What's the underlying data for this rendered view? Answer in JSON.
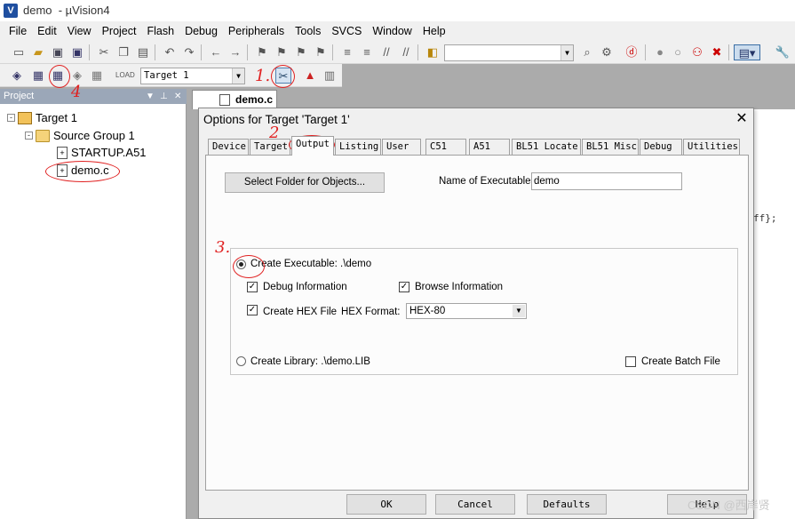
{
  "window": {
    "title": "demo  - µVision4"
  },
  "menu": [
    "File",
    "Edit",
    "View",
    "Project",
    "Flash",
    "Debug",
    "Peripherals",
    "Tools",
    "SVCS",
    "Window",
    "Help"
  ],
  "toolbar": {
    "target_combo": "Target 1"
  },
  "project_pane": {
    "title": "Project",
    "tree": {
      "target": "Target 1",
      "group": "Source Group 1",
      "files": [
        "STARTUP.A51",
        "demo.c"
      ]
    }
  },
  "editor": {
    "tab_label": "demo.c",
    "code_fragment": "ff};"
  },
  "dialog": {
    "title": "Options for Target 'Target 1'",
    "tabs": [
      "Device",
      "Target",
      "Output",
      "Listing",
      "User",
      "C51",
      "A51",
      "BL51 Locate",
      "BL51 Misc",
      "Debug",
      "Utilities"
    ],
    "active_tab": "Output",
    "select_folder_button": "Select Folder for Objects...",
    "name_of_executable_label": "Name of Executable:",
    "name_of_executable_value": "demo",
    "create_executable_label": "Create Executable:  .\\demo",
    "debug_information_label": "Debug Information",
    "browse_information_label": "Browse Information",
    "create_hex_label": "Create HEX File",
    "hex_format_label": "HEX Format:",
    "hex_format_value": "HEX-80",
    "create_library_label": "Create Library:  .\\demo.LIB",
    "create_batch_label": "Create Batch File",
    "ok_button": "OK",
    "cancel_button": "Cancel",
    "defaults_button": "Defaults",
    "help_button": "Help"
  },
  "annotations": [
    "1.",
    "2",
    "3.",
    "4"
  ],
  "watermark": "CSDN @西岸贤"
}
